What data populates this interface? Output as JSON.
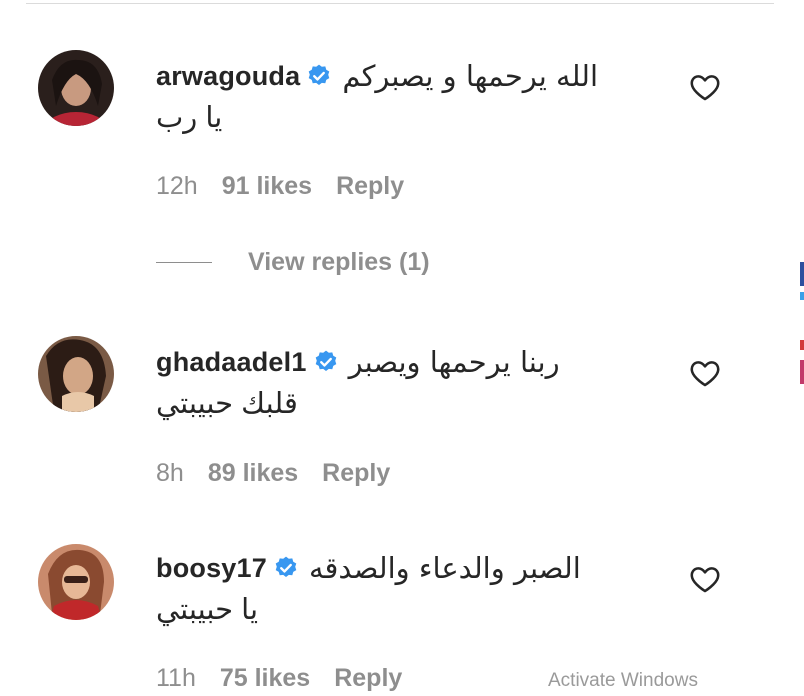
{
  "comments": [
    {
      "username": "arwagouda",
      "text_line1": "الله يرحمها و يصبركم",
      "text_line2": "يا رب",
      "time": "12h",
      "likes": "91 likes",
      "reply": "Reply"
    },
    {
      "username": "ghadaadel1",
      "text_line1": "ربنا يرحمها ويصبر",
      "text_line2": "قلبك حبيبتي",
      "time": "8h",
      "likes": "89 likes",
      "reply": "Reply"
    },
    {
      "username": "boosy17",
      "text_line1": "الصبر والدعاء والصدقه",
      "text_line2": "يا حبيبتي",
      "time": "11h",
      "likes": "75 likes",
      "reply": "Reply"
    }
  ],
  "view_replies": "View replies (1)",
  "watermark": "Activate Windows",
  "colors": {
    "text": "#262626",
    "muted": "#8e8e8e",
    "verified": "#3897f0",
    "divider": "#dbdbdb"
  },
  "icons": {
    "verified": "verified-badge-icon",
    "like": "heart-outline-icon"
  }
}
